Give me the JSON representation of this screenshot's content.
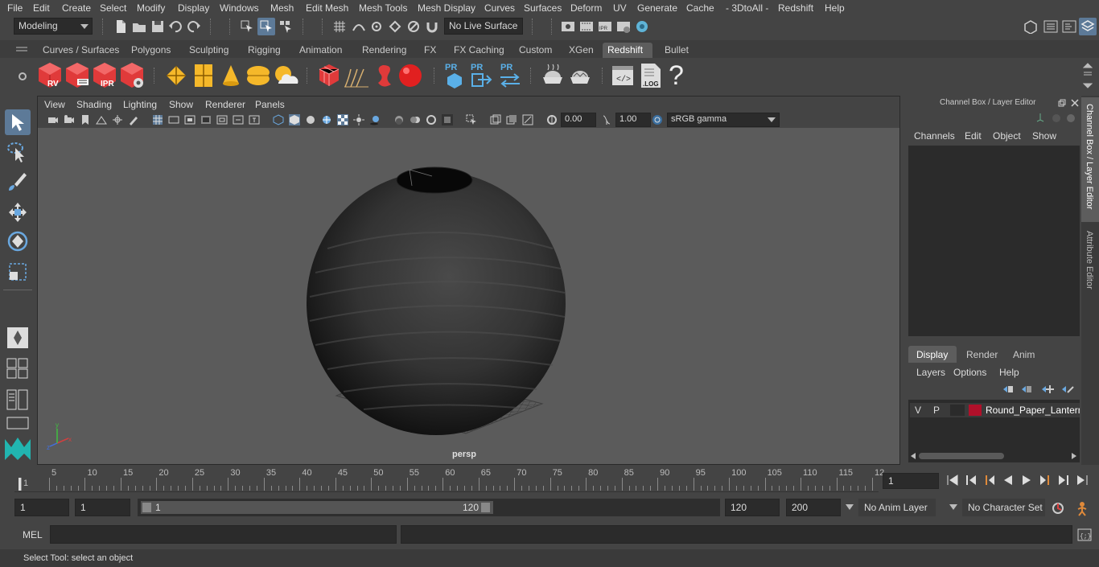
{
  "menu": [
    "File",
    "Edit",
    "Create",
    "Select",
    "Modify",
    "Display",
    "Windows",
    "Mesh",
    "Edit Mesh",
    "Mesh Tools",
    "Mesh Display",
    "Curves",
    "Surfaces",
    "Deform",
    "UV",
    "Generate",
    "Cache",
    "- 3DtoAll -",
    "Redshift",
    "Help"
  ],
  "status": {
    "mode": "Modeling",
    "live_surface": "No Live Surface"
  },
  "shelf_tabs": [
    "Curves / Surfaces",
    "Polygons",
    "Sculpting",
    "Rigging",
    "Animation",
    "Rendering",
    "FX",
    "FX Caching",
    "Custom",
    "XGen",
    "Redshift",
    "Bullet"
  ],
  "active_shelf_tab": "Redshift",
  "shelf_icons": {
    "rv": "RV",
    "ipr": "IPR",
    "pr": "PR",
    "log": ".LOG",
    "help": "?"
  },
  "viewport": {
    "menu": [
      "View",
      "Shading",
      "Lighting",
      "Show",
      "Renderer",
      "Panels"
    ],
    "exposure": "0.00",
    "gamma": "1.00",
    "color_space": "sRGB gamma",
    "camera_label": "persp"
  },
  "channel_box": {
    "title": "Channel Box / Layer Editor",
    "menu": [
      "Channels",
      "Edit",
      "Object",
      "Show"
    ],
    "layer_tabs": [
      "Display",
      "Render",
      "Anim"
    ],
    "active_layer_tab": "Display",
    "layer_menu": [
      "Layers",
      "Options",
      "Help"
    ],
    "layer": {
      "v": "V",
      "p": "P",
      "color": "#b0102a",
      "name": "Round_Paper_Lantern"
    }
  },
  "side_tabs": [
    "Channel Box / Layer Editor",
    "Attribute Editor"
  ],
  "timeline": {
    "ticks": [
      "1",
      "5",
      "10",
      "15",
      "20",
      "25",
      "30",
      "35",
      "40",
      "45",
      "50",
      "55",
      "60",
      "65",
      "70",
      "75",
      "80",
      "85",
      "90",
      "95",
      "100",
      "105",
      "110",
      "115",
      "12"
    ],
    "current_frame": "1"
  },
  "range": {
    "start": "1",
    "playback_start": "1",
    "slider_start": "1",
    "slider_end": "120",
    "playback_end": "120",
    "end": "200",
    "anim_layer": "No Anim Layer",
    "character_set": "No Character Set"
  },
  "cmd": {
    "lang": "MEL"
  },
  "help_line": "Select Tool: select an object"
}
